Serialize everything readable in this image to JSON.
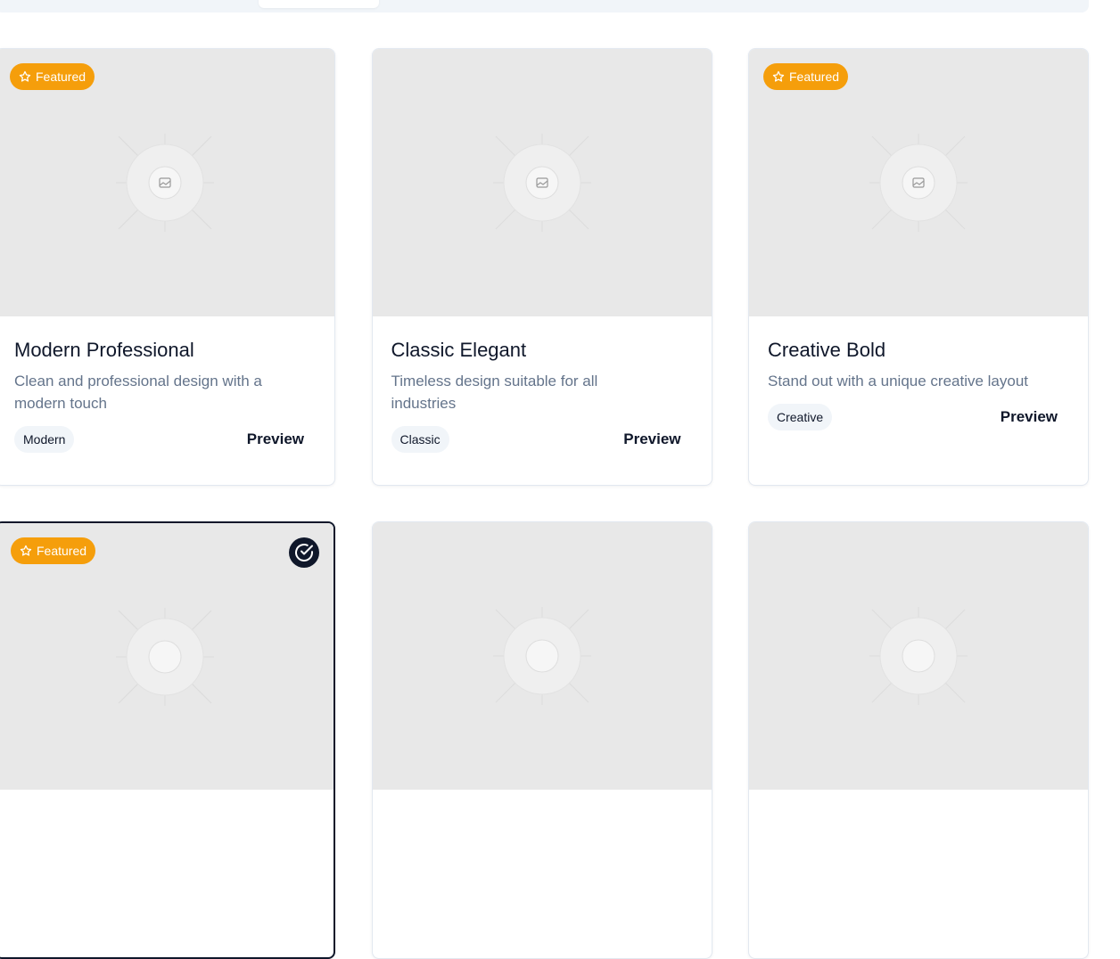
{
  "tabs": {
    "active_label": ""
  },
  "cards": [
    {
      "title": "Modern Professional",
      "description": "Clean and professional design with a modern touch",
      "tag": "Modern",
      "preview_label": "Preview",
      "featured": true,
      "featured_label": "Featured"
    },
    {
      "title": "Classic Elegant",
      "description": "Timeless design suitable for all industries",
      "tag": "Classic",
      "preview_label": "Preview",
      "featured": false
    },
    {
      "title": "Creative Bold",
      "description": "Stand out with a unique creative layout",
      "tag": "Creative",
      "preview_label": "Preview",
      "featured": true,
      "featured_label": "Featured"
    },
    {
      "featured": true,
      "featured_label": "Featured",
      "selected": true
    },
    {
      "featured": false
    },
    {
      "featured": false
    }
  ],
  "colors": {
    "featured_badge": "#f59e0b",
    "selected_border": "#0f172a",
    "thumb_bg": "#e8e8e8",
    "tag_bg": "#f1f5f9",
    "muted_text": "#64748b"
  },
  "icons": {
    "featured": "star-icon",
    "selected": "check-circle-icon",
    "placeholder": "image-icon"
  }
}
